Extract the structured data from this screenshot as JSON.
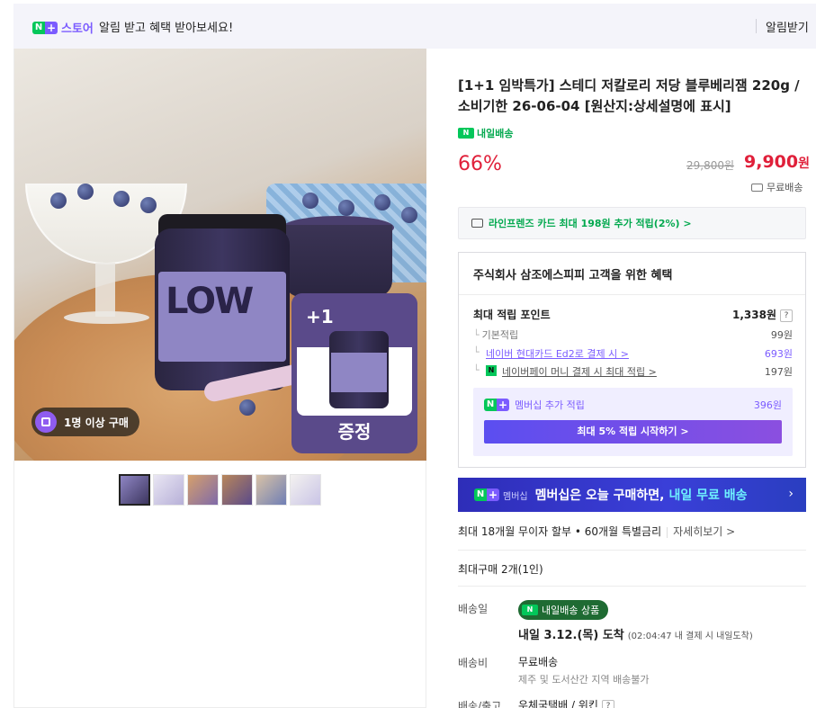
{
  "banner": {
    "store_label": "스토어",
    "message": "알림 받고 혜택 받아보세요!",
    "notify_label": "알림받기"
  },
  "gallery": {
    "jar_label": "LOW",
    "gift_plus": "+1",
    "gift_label": "증정",
    "min_qty_badge": "1명 이상 구매",
    "thumbnail_count": 6
  },
  "product": {
    "title": "[1+1 임박특가] 스테디 저칼로리 저당 블루베리잼 220g / 소비기한 26-06-04 [원산지:상세설명에 표시]",
    "delivery_tag": "내일배송",
    "discount": "66%",
    "original_price": "29,800원",
    "sale_price": "9,900",
    "price_unit": "원",
    "free_shipping": "무료배송"
  },
  "card_benefit": "라인프렌즈 카드 최대 198원 추가 적립(2%) >",
  "benefits": {
    "heading": "주식회사 삼조에스피피 고객을 위한 혜택",
    "max_points_label": "최대 적립 포인트",
    "max_points_value": "1,338원",
    "help": "?",
    "basic_label": "기본적립",
    "basic_value": "99원",
    "hyundai_label": "네이버 현대카드 Ed2로 결제 시 >",
    "hyundai_value": "693원",
    "npay_label": "네이버페이 머니 결제 시 최대 적립 >",
    "npay_value": "197원",
    "member_label": "멤버십 추가 적립",
    "member_value": "396원",
    "member_button": "최대 5% 적립 시작하기 >"
  },
  "promo": {
    "badge_word": "멤버십",
    "text": "멤버십은 오늘 구매하면,",
    "accent": "내일 무료 배송",
    "chevron": "›"
  },
  "installment": {
    "text": "최대 18개월 무이자 할부 • 60개월 특별금리",
    "link": "자세히보기 >"
  },
  "max_purchase": "최대구매 2개(1인)",
  "shipping": {
    "date_label": "배송일",
    "badge": "내일배송 상품",
    "arrival": "내일 3.12.(목) 도착",
    "arrival_note": "(02:04:47 내 결제 시 내일도착)",
    "fee_label": "배송비",
    "fee_value": "무료배송",
    "fee_note": "제주 및 도서산간 지역 배송불가",
    "carrier_label": "배송/출고",
    "carrier_value": "우체국택배 / 위킨"
  },
  "colors": {
    "naver_green": "#03c75a",
    "accent_purple": "#7b5cff",
    "price_red": "#e0203a"
  }
}
